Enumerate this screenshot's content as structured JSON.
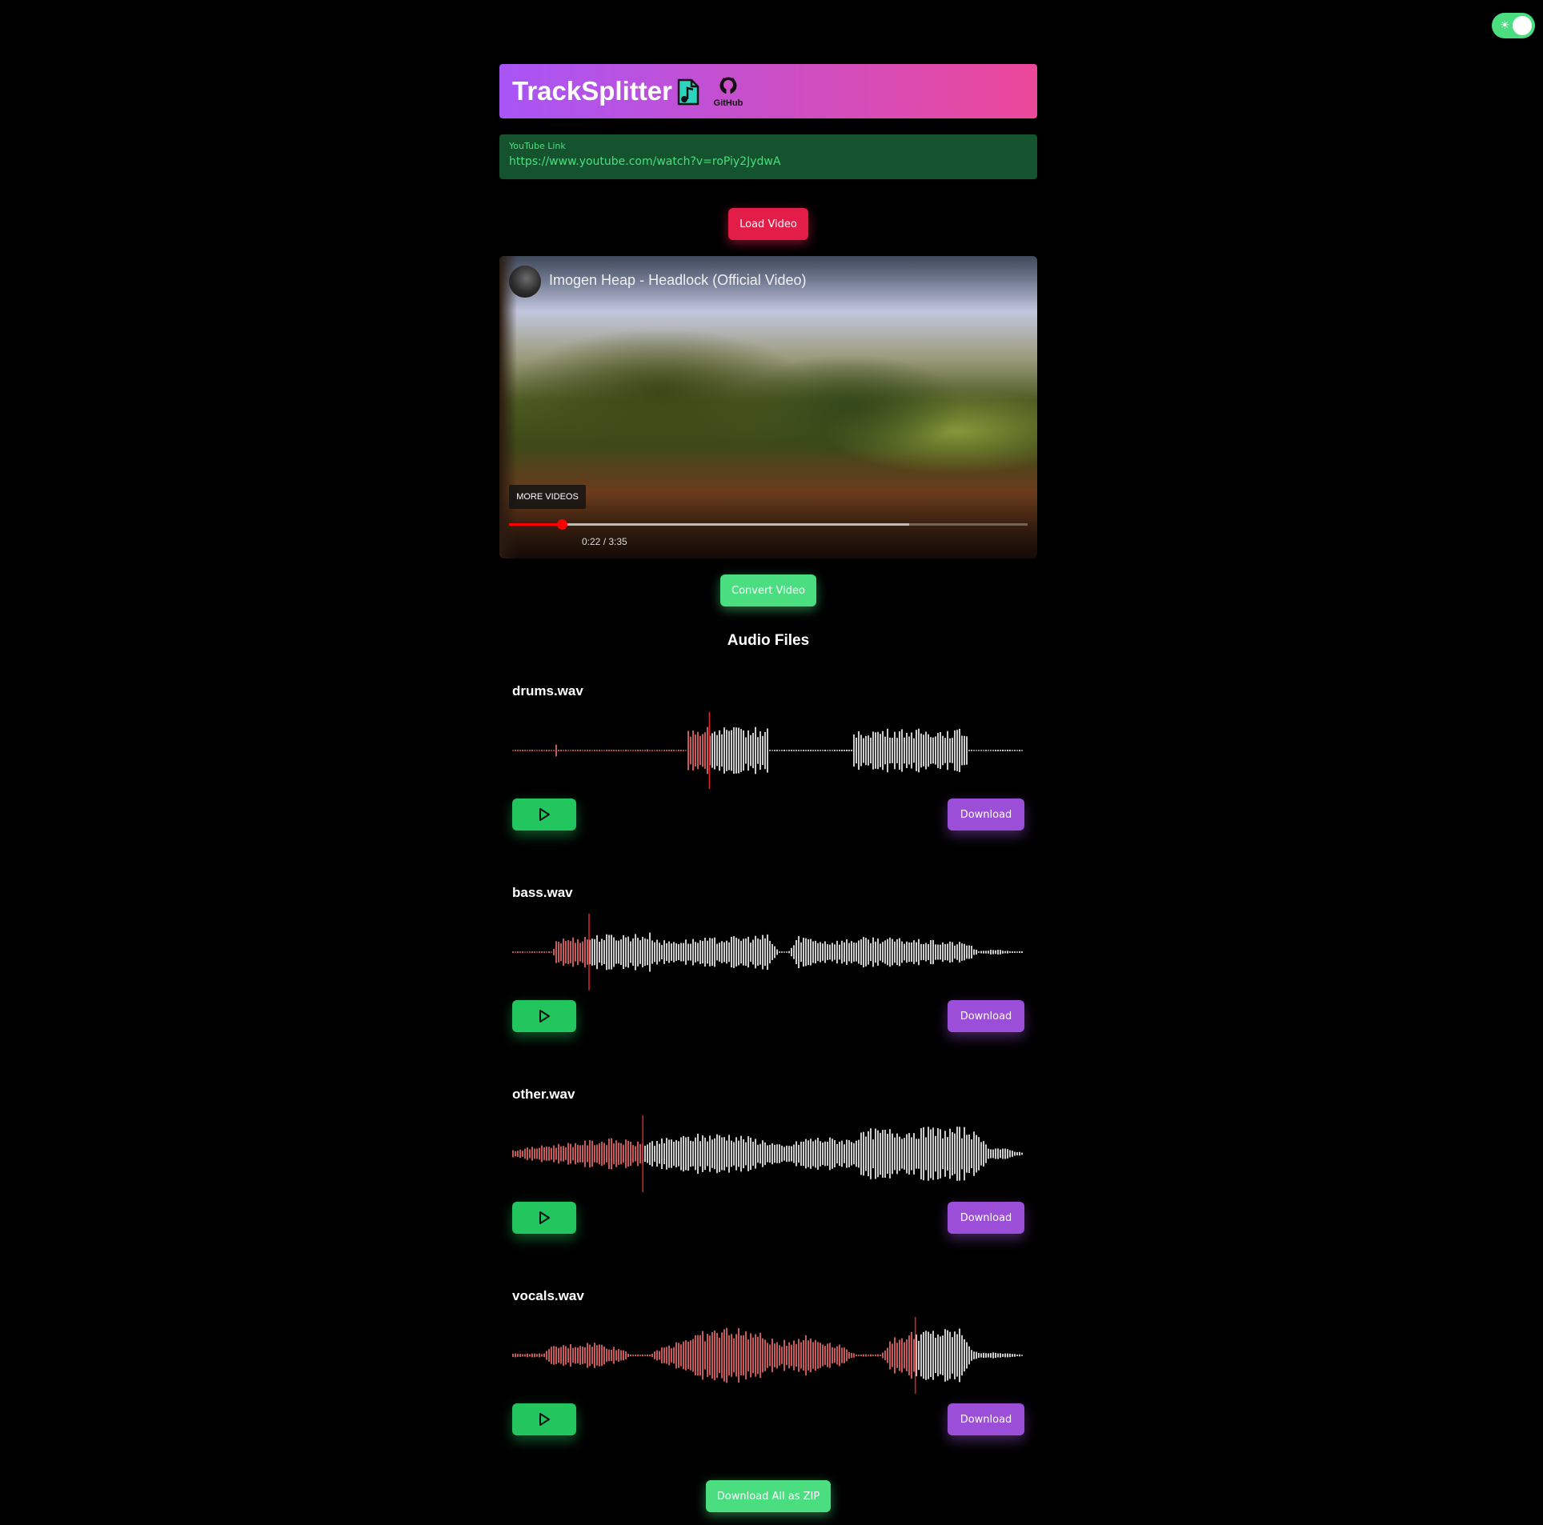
{
  "theme_toggle": {
    "icon": "sun-icon",
    "state": "on"
  },
  "header": {
    "title": "TrackSplitter",
    "music_icon": "music-file-icon",
    "github_icon": "github-icon",
    "github_label": "GitHub"
  },
  "url_input": {
    "label": "YouTube Link",
    "value": "https://www.youtube.com/watch?v=roPiy2JydwA"
  },
  "load_button": "Load Video",
  "video": {
    "title": "Imogen Heap - Headlock (Official Video)",
    "more_videos": "MORE VIDEOS",
    "time": "0:22 / 3:35",
    "progress_fraction": 0.102
  },
  "convert_button": "Convert Video",
  "audio_section_title": "Audio Files",
  "tracks": [
    {
      "filename": "drums.wav",
      "download_label": "Download",
      "play_icon": "play-icon",
      "progress_fraction": 0.385
    },
    {
      "filename": "bass.wav",
      "download_label": "Download",
      "play_icon": "play-icon",
      "progress_fraction": 0.15
    },
    {
      "filename": "other.wav",
      "download_label": "Download",
      "play_icon": "play-icon",
      "progress_fraction": 0.255
    },
    {
      "filename": "vocals.wav",
      "download_label": "Download",
      "play_icon": "play-icon",
      "progress_fraction": 0.787
    }
  ],
  "zip_button": "Download All as ZIP",
  "colors": {
    "header_gradient_start": "#a855f7",
    "header_gradient_end": "#ec4899",
    "load_button": "#e11d48",
    "accent_green": "#4ade80",
    "play_button": "#22c55e",
    "download_button": "#9b4fd8",
    "wave_played": "#f87171",
    "wave_unplayed": "#ffffff"
  }
}
